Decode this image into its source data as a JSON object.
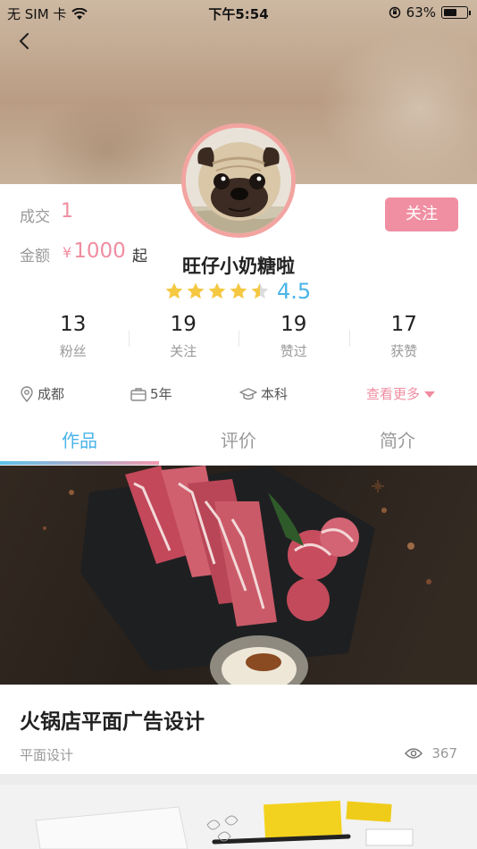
{
  "status_bar": {
    "carrier": "无 SIM 卡",
    "time": "下午5:54",
    "battery_percent": "63%",
    "battery_level": 0.63
  },
  "profile": {
    "deal_label": "成交",
    "deal_value": "1",
    "amount_label": "金额",
    "currency_symbol": "¥",
    "amount_value": "1000",
    "amount_suffix": "起",
    "follow_label": "关注",
    "name": "旺仔小奶糖啦",
    "rating_value": "4.5",
    "rating_stars": 4.5
  },
  "stats": [
    {
      "value": "13",
      "label": "粉丝"
    },
    {
      "value": "19",
      "label": "关注"
    },
    {
      "value": "19",
      "label": "赞过"
    },
    {
      "value": "17",
      "label": "获赞"
    }
  ],
  "info": {
    "location": "成都",
    "experience": "5年",
    "education": "本科",
    "more_label": "查看更多"
  },
  "tabs": [
    {
      "label": "作品",
      "active": true
    },
    {
      "label": "评价",
      "active": false
    },
    {
      "label": "简介",
      "active": false
    }
  ],
  "works": [
    {
      "title": "火锅店平面广告设计",
      "category": "平面设计",
      "views": "367"
    }
  ],
  "colors": {
    "accent_pink": "#ef8da0",
    "accent_blue": "#4ab4e8",
    "star_yellow": "#f5c842"
  }
}
